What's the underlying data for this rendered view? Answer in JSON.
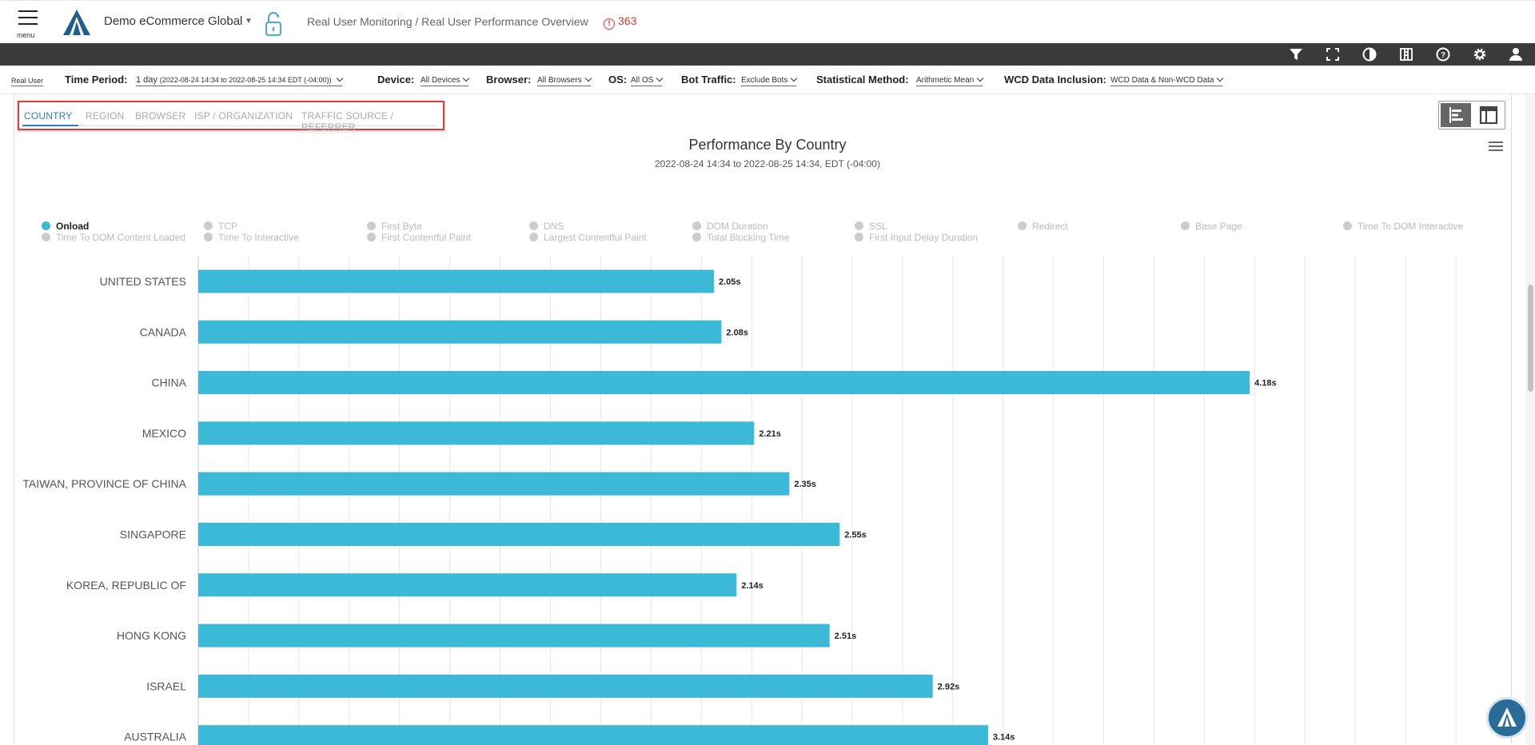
{
  "header": {
    "menu_label": "menu",
    "org_name": "Demo eCommerce Global",
    "breadcrumb": "Real User Monitoring / Real User Performance Overview",
    "alert_count": "363",
    "alert_color": "#e0352b",
    "brand_color": "#1f5f8b"
  },
  "toolbar": {
    "icons": [
      "filter-icon",
      "fullscreen-icon",
      "contrast-icon",
      "columns-icon",
      "help-icon",
      "gear-icon",
      "user-icon"
    ]
  },
  "filters": {
    "mode": "Real User",
    "time_period_label": "Time Period:",
    "time_period_value": "1 day",
    "time_period_range": "(2022-08-24 14:34 to 2022-08-25 14:34 EDT (-04:00))",
    "device_label": "Device:",
    "device_value": "All Devices",
    "browser_label": "Browser:",
    "browser_value": "All Browsers",
    "os_label": "OS:",
    "os_value": "All OS",
    "bot_label": "Bot Traffic:",
    "bot_value": "Exclude Bots",
    "stat_label": "Statistical Method:",
    "stat_value": "Arithmetic Mean",
    "wcd_label": "WCD Data Inclusion:",
    "wcd_value": "WCD Data & Non-WCD Data"
  },
  "tabs": [
    {
      "label": "COUNTRY",
      "active": true
    },
    {
      "label": "REGION",
      "active": false
    },
    {
      "label": "BROWSER",
      "active": false
    },
    {
      "label": "ISP / ORGANIZATION",
      "active": false
    },
    {
      "label": "TRAFFIC SOURCE / REFERRER",
      "active": false
    }
  ],
  "legend": [
    {
      "label": "Onload",
      "active": true
    },
    {
      "label": "TCP",
      "active": false
    },
    {
      "label": "First Byte",
      "active": false
    },
    {
      "label": "DNS",
      "active": false
    },
    {
      "label": "DOM Duration",
      "active": false
    },
    {
      "label": "SSL",
      "active": false
    },
    {
      "label": "Redirect",
      "active": false
    },
    {
      "label": "Base Page",
      "active": false
    },
    {
      "label": "Time To DOM Interactive",
      "active": false
    },
    {
      "label": "Time To DOM Content Loaded",
      "active": false
    },
    {
      "label": "Time To Interactive",
      "active": false
    },
    {
      "label": "First Contentful Paint",
      "active": false
    },
    {
      "label": "Largest Contentful Paint",
      "active": false
    },
    {
      "label": "Total Blocking Time",
      "active": false
    },
    {
      "label": "First Input Delay Duration",
      "active": false
    }
  ],
  "chart_data": {
    "type": "bar",
    "orientation": "horizontal",
    "title": "Performance By Country",
    "subtitle": "2022-08-24 14:34 to 2022-08-25 14:34, EDT (-04:00)",
    "categories": [
      "UNITED STATES",
      "CANADA",
      "CHINA",
      "MEXICO",
      "TAIWAN, PROVINCE OF CHINA",
      "SINGAPORE",
      "KOREA, REPUBLIC OF",
      "HONG KONG",
      "ISRAEL",
      "AUSTRALIA"
    ],
    "series": [
      {
        "name": "Onload",
        "values": [
          2.05,
          2.08,
          4.18,
          2.21,
          2.35,
          2.55,
          2.14,
          2.51,
          2.92,
          3.14
        ],
        "color": "#3cb9d6"
      }
    ],
    "value_labels": [
      "2.05s",
      "2.08s",
      "4.18s",
      "2.21s",
      "2.35s",
      "2.55s",
      "2.14s",
      "2.51s",
      "2.92s",
      "3.14s"
    ],
    "xlim": [
      0,
      5.2
    ],
    "grid": true,
    "legend_position": "top"
  }
}
